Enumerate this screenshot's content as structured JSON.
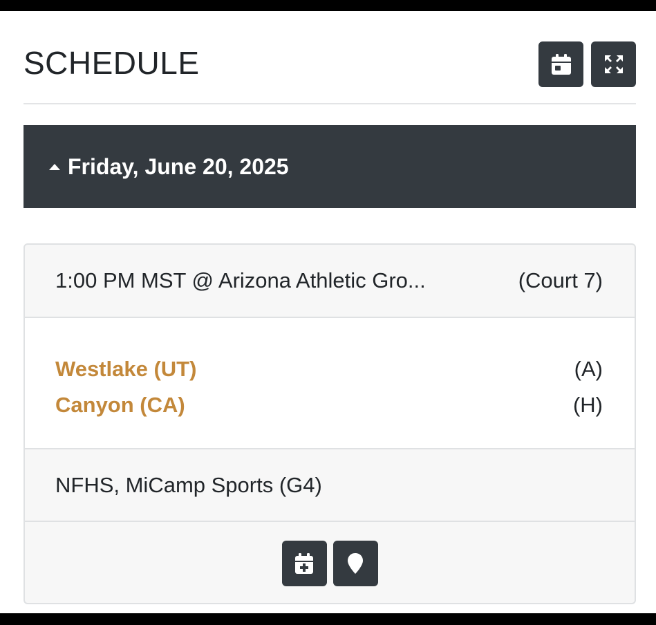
{
  "header": {
    "title": "SCHEDULE",
    "calendar_icon": "calendar-icon",
    "expand_icon": "expand-arrows-icon"
  },
  "day": {
    "label": "Friday, June 20, 2025",
    "caret_icon": "caret-up-icon"
  },
  "game": {
    "time_location": "1:00 PM MST @ Arizona Athletic Gro...",
    "court": "(Court 7)",
    "teams": [
      {
        "name": "Westlake (UT)",
        "side": "(A)"
      },
      {
        "name": "Canyon (CA)",
        "side": "(H)"
      }
    ],
    "info": "NFHS, MiCamp Sports (G4)",
    "actions": [
      {
        "icon": "calendar-plus-icon"
      },
      {
        "icon": "map-marker-icon"
      }
    ]
  },
  "colors": {
    "dark": "#343a40",
    "accent": "#c3883a",
    "card_bg": "#f7f7f7"
  }
}
